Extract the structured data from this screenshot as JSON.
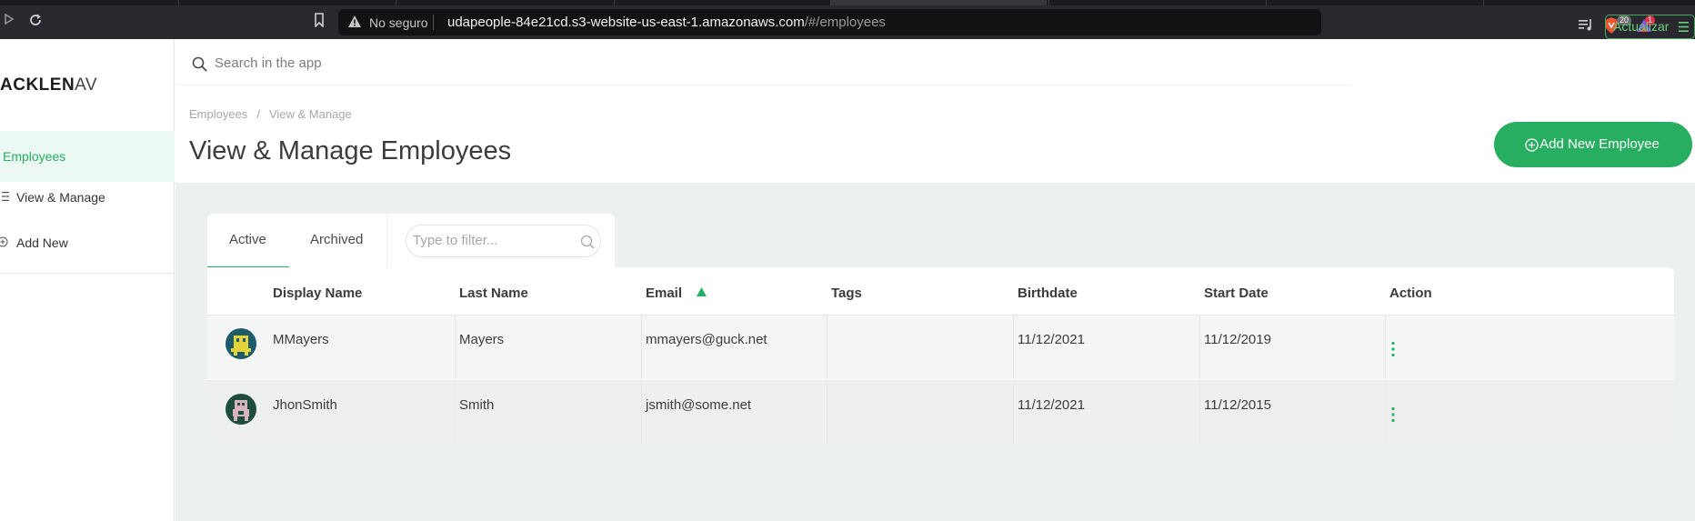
{
  "browser": {
    "insecure_label": "No seguro",
    "url_host": "udapeople-84e21cd.s3-website-us-east-1.amazonaws.com",
    "url_path": "/#/employees",
    "shields_count": "20",
    "rewards_count": "1",
    "update_label": "Actualizar"
  },
  "sidebar": {
    "logo_bold": "ACKLEN",
    "logo_thin": "AV",
    "items": [
      {
        "label": "Employees"
      },
      {
        "label": "View & Manage"
      },
      {
        "label": "Add New"
      }
    ]
  },
  "header": {
    "search_placeholder": "Search in the app",
    "breadcrumb": [
      "Employees",
      "View & Manage"
    ],
    "breadcrumb_sep": "/",
    "title": "View & Manage Employees",
    "add_button_label": "Add New Employee"
  },
  "tabs": {
    "active_label": "Active",
    "archived_label": "Archived",
    "filter_placeholder": "Type to filter..."
  },
  "table": {
    "columns": [
      "Display Name",
      "Last Name",
      "Email",
      "Tags",
      "Birthdate",
      "Start Date",
      "Action"
    ],
    "rows": [
      {
        "display_name": "MMayers",
        "last_name": "Mayers",
        "email": "mmayers@guck.net",
        "tags": "",
        "birthdate": "11/12/2021",
        "start_date": "11/12/2019"
      },
      {
        "display_name": "JhonSmith",
        "last_name": "Smith",
        "email": "jsmith@some.net",
        "tags": "",
        "birthdate": "11/12/2021",
        "start_date": "11/12/2015"
      }
    ]
  },
  "colors": {
    "accent": "#27ae60",
    "content_bg": "#ecf0ef"
  }
}
